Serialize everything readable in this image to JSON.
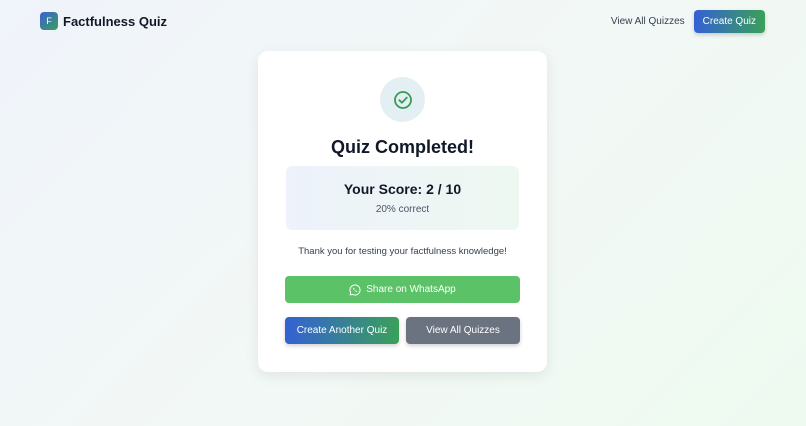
{
  "header": {
    "logo_letter": "F",
    "brand": "Factfulness Quiz",
    "nav_link": "View All Quizzes",
    "create_button": "Create Quiz"
  },
  "result": {
    "title": "Quiz Completed!",
    "score_text": "Your Score: 2 / 10",
    "score_percent_text": "20% correct",
    "thanks": "Thank you for testing your factfulness knowledge!"
  },
  "actions": {
    "share_whatsapp": "Share on WhatsApp",
    "create_another": "Create Another Quiz",
    "view_all": "View All Quizzes"
  },
  "icons": {
    "success": "check-circle-icon",
    "share": "whatsapp-icon"
  },
  "colors": {
    "primary_gradient_start": "#3461d4",
    "primary_gradient_end": "#3aa05a",
    "whatsapp_green": "#5cc268",
    "secondary_gray": "#6b7280",
    "success_check": "#3a9a57"
  }
}
